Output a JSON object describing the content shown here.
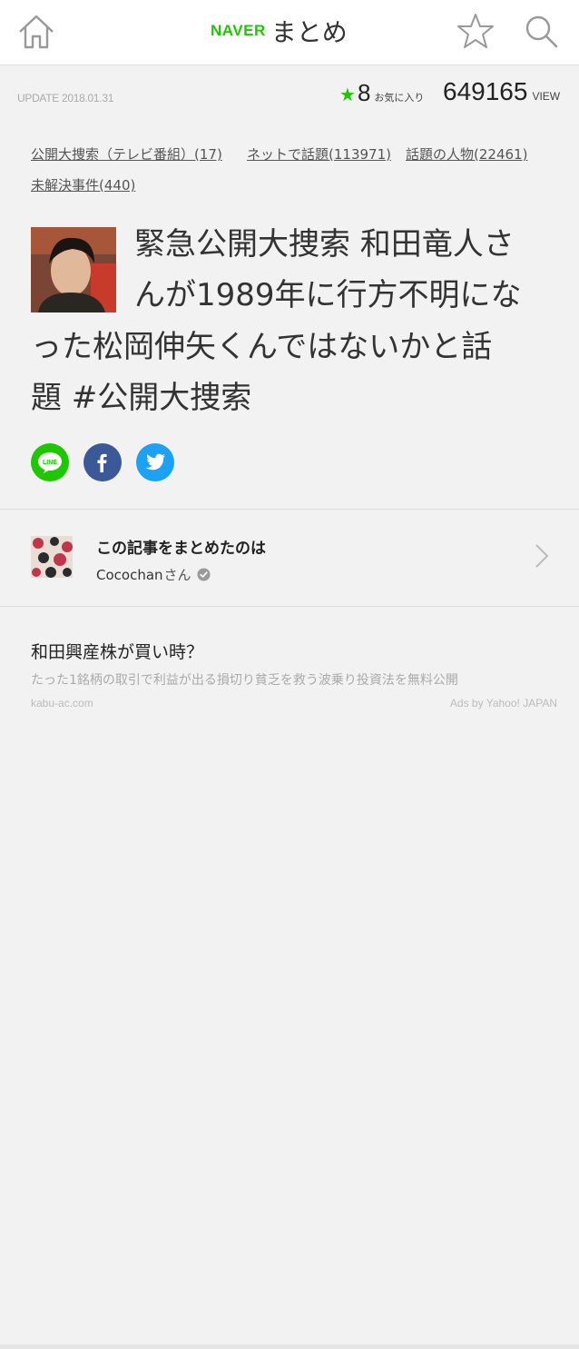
{
  "header": {
    "logo_brand": "NAVER",
    "logo_text": "まとめ",
    "home_icon": "home-icon",
    "favorite_icon": "star-outline-icon",
    "search_icon": "search-icon"
  },
  "meta": {
    "update": "UPDATE 2018.01.31",
    "favorite_count": "8",
    "favorite_label": "お気に入り",
    "view_count": "649165",
    "view_label": "VIEW"
  },
  "tags": [
    "公開大捜索（テレビ番組）(17)",
    "ネットで話題(113971)",
    "話題の人物(22461)",
    "未解決事件(440)"
  ],
  "title": {
    "lines": [
      "緊急公開大捜索 和田竜人さ",
      "んが1989年に行方不明にな",
      "った松岡伸矢くんではないかと話",
      "題 #公開大捜索"
    ]
  },
  "share": {
    "line_label": "LINE",
    "icons": [
      "line-icon",
      "facebook-icon",
      "twitter-icon"
    ]
  },
  "author": {
    "heading": "この記事をまとめたのは",
    "name": "Cocochan",
    "suffix": "さん"
  },
  "ad": {
    "title": "和田興産株が買い時？",
    "description": "たった1銘柄の取引で利益が出る損切り貧乏を救う波乗り投資法を無料公開",
    "domain": "kabu-ac.com",
    "by": "Ads by Yahoo! JAPAN"
  },
  "colors": {
    "accent": "#1ec800",
    "facebook": "#3b5998",
    "twitter": "#1da1f2"
  }
}
